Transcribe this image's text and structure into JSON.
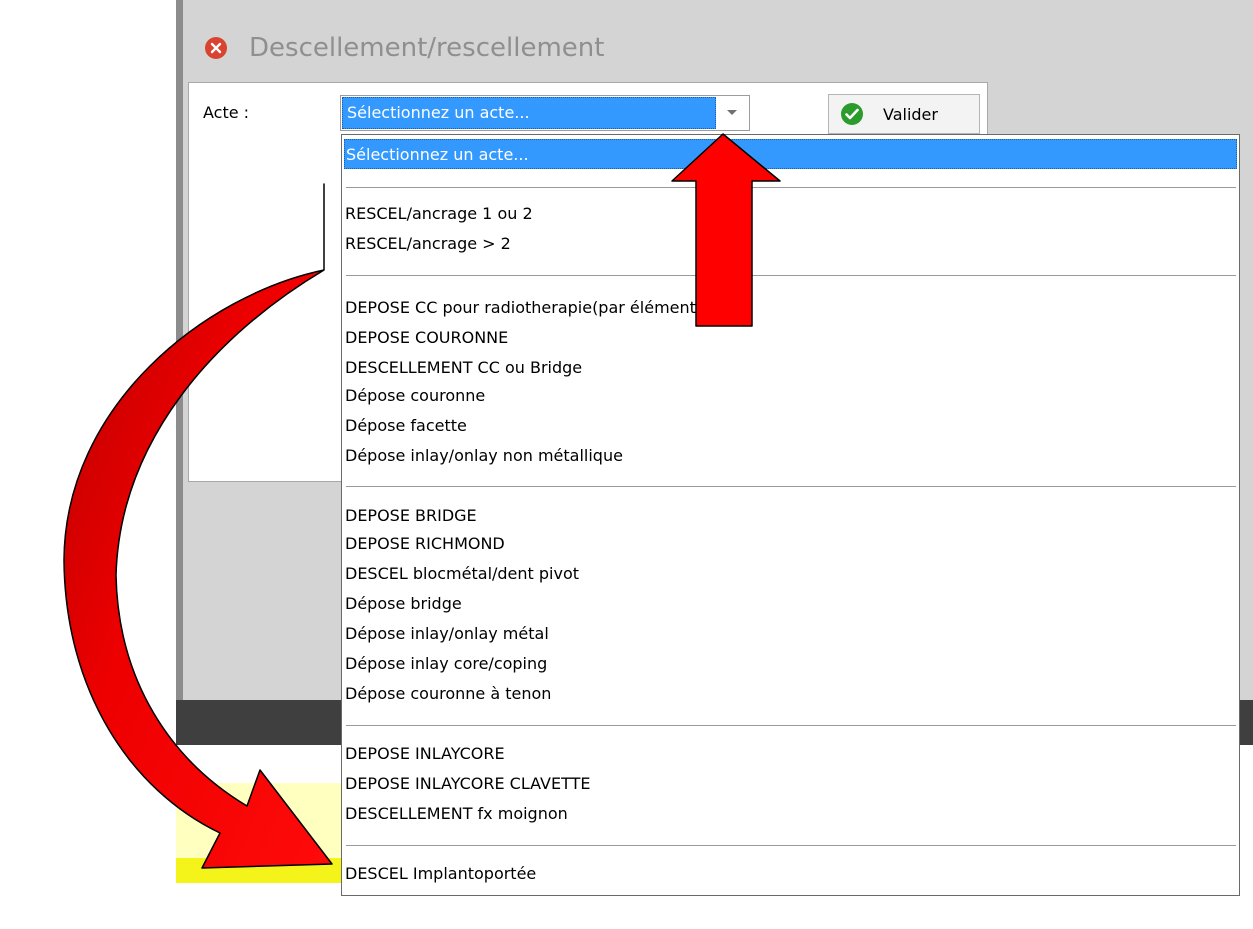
{
  "dialog": {
    "title": "Descellement/rescellement",
    "acte_label": "Acte :",
    "combo_value": "Sélectionnez un acte...",
    "validate_label": "Valider"
  },
  "dropdown": {
    "groups": [
      [
        "Sélectionnez un acte..."
      ],
      [
        "RESCEL/ancrage 1 ou 2",
        "RESCEL/ancrage > 2"
      ],
      [
        "DEPOSE CC pour radiotherapie(par élément",
        "DEPOSE COURONNE",
        "DESCELLEMENT CC ou Bridge",
        "Dépose couronne",
        "Dépose facette",
        "Dépose inlay/onlay non métallique"
      ],
      [
        "DEPOSE BRIDGE",
        "DEPOSE RICHMOND",
        "DESCEL blocmétal/dent pivot",
        "Dépose bridge",
        "Dépose inlay/onlay métal",
        "Dépose inlay core/coping",
        "Dépose couronne à tenon"
      ],
      [
        "DEPOSE INLAYCORE",
        "DEPOSE INLAYCORE CLAVETTE",
        "DESCELLEMENT fx moignon"
      ],
      [
        "DESCEL Implantoportée"
      ]
    ],
    "selected": "Sélectionnez un acte..."
  },
  "colors": {
    "selection": "#3399ff",
    "annotation": "#ff0000",
    "dialog_bg": "#d4d4d4",
    "dark_band": "#3f3f3f",
    "highlight_yellow": "#ffffc0"
  },
  "icons": {
    "close": "close-circle-icon",
    "validate": "check-circle-icon",
    "dropdown": "chevron-down-icon"
  }
}
